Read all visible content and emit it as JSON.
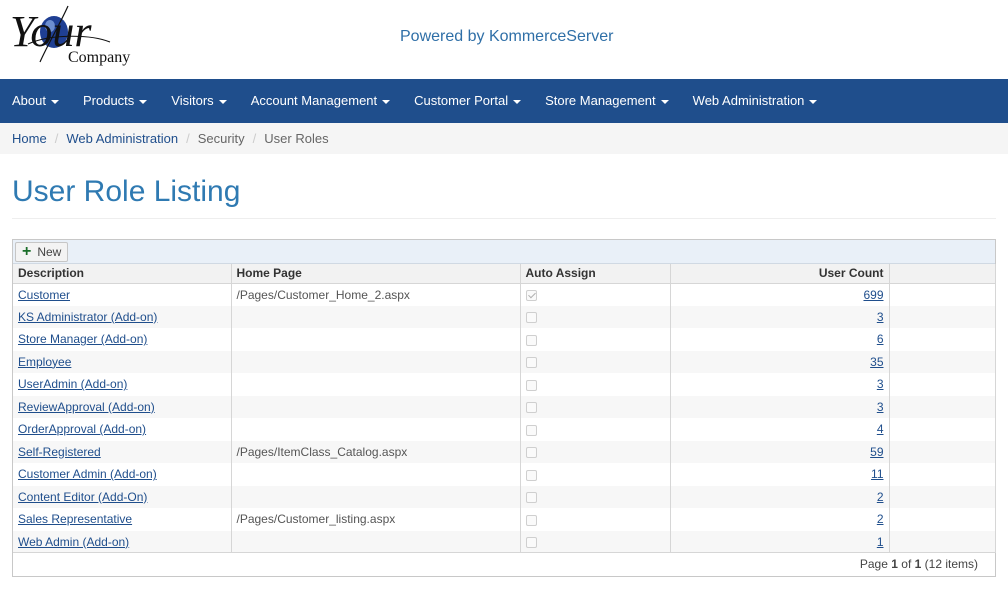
{
  "header": {
    "logo_text_main": "Your",
    "logo_text_sub": "Company",
    "powered_by": "Powered by KommerceServer"
  },
  "nav": [
    {
      "label": "About"
    },
    {
      "label": "Products"
    },
    {
      "label": "Visitors"
    },
    {
      "label": "Account Management"
    },
    {
      "label": "Customer Portal"
    },
    {
      "label": "Store Management"
    },
    {
      "label": "Web Administration"
    }
  ],
  "breadcrumb": {
    "home": "Home",
    "web_admin": "Web Administration",
    "security": "Security",
    "current": "User Roles"
  },
  "page": {
    "title": "User Role Listing"
  },
  "grid": {
    "new_label": "New",
    "columns": {
      "description": "Description",
      "home_page": "Home Page",
      "auto_assign": "Auto Assign",
      "user_count": "User Count"
    },
    "rows": [
      {
        "description": "Customer",
        "home_page": "/Pages/Customer_Home_2.aspx",
        "auto_assign": true,
        "user_count": "699"
      },
      {
        "description": "KS Administrator (Add-on)",
        "home_page": "",
        "auto_assign": false,
        "user_count": "3"
      },
      {
        "description": "Store Manager (Add-on)",
        "home_page": "",
        "auto_assign": false,
        "user_count": "6"
      },
      {
        "description": "Employee",
        "home_page": "",
        "auto_assign": false,
        "user_count": "35"
      },
      {
        "description": "UserAdmin (Add-on)",
        "home_page": "",
        "auto_assign": false,
        "user_count": "3"
      },
      {
        "description": "ReviewApproval (Add-on)",
        "home_page": "",
        "auto_assign": false,
        "user_count": "3"
      },
      {
        "description": "OrderApproval (Add-on)",
        "home_page": "",
        "auto_assign": false,
        "user_count": "4"
      },
      {
        "description": "Self-Registered",
        "home_page": "/Pages/ItemClass_Catalog.aspx",
        "auto_assign": false,
        "user_count": "59"
      },
      {
        "description": "Customer Admin (Add-on)",
        "home_page": "",
        "auto_assign": false,
        "user_count": "11"
      },
      {
        "description": "Content Editor (Add-On)",
        "home_page": "",
        "auto_assign": false,
        "user_count": "2"
      },
      {
        "description": "Sales Representative",
        "home_page": "/Pages/Customer_listing.aspx",
        "auto_assign": false,
        "user_count": "2"
      },
      {
        "description": "Web Admin (Add-on)",
        "home_page": "",
        "auto_assign": false,
        "user_count": "1"
      }
    ],
    "pager": {
      "page_word": "Page",
      "current": "1",
      "of_word": "of",
      "total": "1",
      "items": "(12 items)"
    }
  }
}
